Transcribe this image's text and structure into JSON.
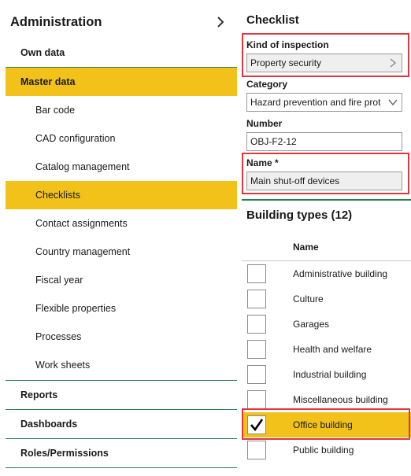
{
  "nav": {
    "title": "Administration",
    "items_top": [
      {
        "label": "Own data"
      },
      {
        "label": "Master data"
      }
    ],
    "subitems": [
      {
        "label": "Bar code"
      },
      {
        "label": "CAD configuration"
      },
      {
        "label": "Catalog management"
      },
      {
        "label": "Checklists"
      },
      {
        "label": "Contact assignments"
      },
      {
        "label": "Country management"
      },
      {
        "label": "Fiscal year"
      },
      {
        "label": "Flexible properties"
      },
      {
        "label": "Processes"
      },
      {
        "label": "Work sheets"
      }
    ],
    "items_bottom": [
      {
        "label": "Reports"
      },
      {
        "label": "Dashboards"
      },
      {
        "label": "Roles/Permissions"
      }
    ],
    "active_top": "Master data",
    "active_sub": "Checklists"
  },
  "checklist": {
    "title": "Checklist",
    "kind_label": "Kind of inspection",
    "kind_value": "Property security",
    "category_label": "Category",
    "category_value": "Hazard prevention and fire prot",
    "number_label": "Number",
    "number_value": "OBJ-F2-12",
    "name_label": "Name *",
    "name_value": "Main shut-off devices"
  },
  "building_types": {
    "title": "Building types (12)",
    "column_name": "Name",
    "rows": [
      {
        "name": "Administrative building",
        "checked": false
      },
      {
        "name": "Culture",
        "checked": false
      },
      {
        "name": "Garages",
        "checked": false
      },
      {
        "name": "Health and welfare",
        "checked": false
      },
      {
        "name": "Industrial building",
        "checked": false
      },
      {
        "name": "Miscellaneous building",
        "checked": false
      },
      {
        "name": "Office building",
        "checked": true
      },
      {
        "name": "Public building",
        "checked": false
      }
    ]
  },
  "colors": {
    "accent": "#f2c21b",
    "divider": "#2e7d4f",
    "highlight": "#e0363c"
  }
}
